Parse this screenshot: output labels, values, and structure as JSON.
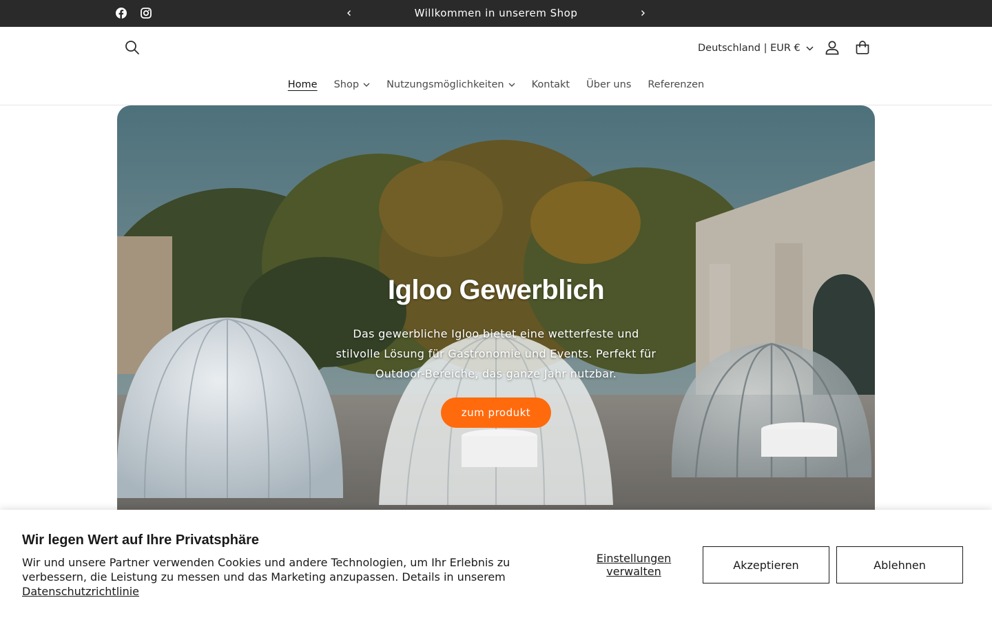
{
  "announcement": {
    "message": "Willkommen in unserem Shop",
    "social": [
      "facebook-icon",
      "instagram-icon"
    ]
  },
  "header": {
    "country_selector": "Deutschland | EUR €",
    "icons": [
      "search-icon",
      "account-icon",
      "cart-icon"
    ]
  },
  "nav": {
    "items": [
      {
        "label": "Home",
        "active": true,
        "dropdown": false
      },
      {
        "label": "Shop",
        "active": false,
        "dropdown": true
      },
      {
        "label": "Nutzungsmöglichkeiten",
        "active": false,
        "dropdown": true
      },
      {
        "label": "Kontakt",
        "active": false,
        "dropdown": false
      },
      {
        "label": "Über uns",
        "active": false,
        "dropdown": false
      },
      {
        "label": "Referenzen",
        "active": false,
        "dropdown": false
      }
    ]
  },
  "hero": {
    "title": "Igloo Gewerblich",
    "text": "Das gewerbliche Igloo bietet eine wetterfeste und stilvolle Lösung für Gastronomie und Events. Perfekt für Outdoor-Bereiche, das ganze Jahr nutzbar.",
    "button": "zum produkt"
  },
  "cookie": {
    "title": "Wir legen Wert auf Ihre Privatsphäre",
    "text": "Wir und unsere Partner verwenden Cookies und andere Technologien, um Ihr Erlebnis zu verbessern, die Leistung zu messen und das Marketing anzupassen. Details in unserem",
    "link": "Datenschutzrichtlinie",
    "manage": "Einstellungen verwalten",
    "accept": "Akzeptieren",
    "decline": "Ablehnen"
  },
  "colors": {
    "accent": "#ff6a0d",
    "announcement_bg": "#2a2a2a"
  }
}
